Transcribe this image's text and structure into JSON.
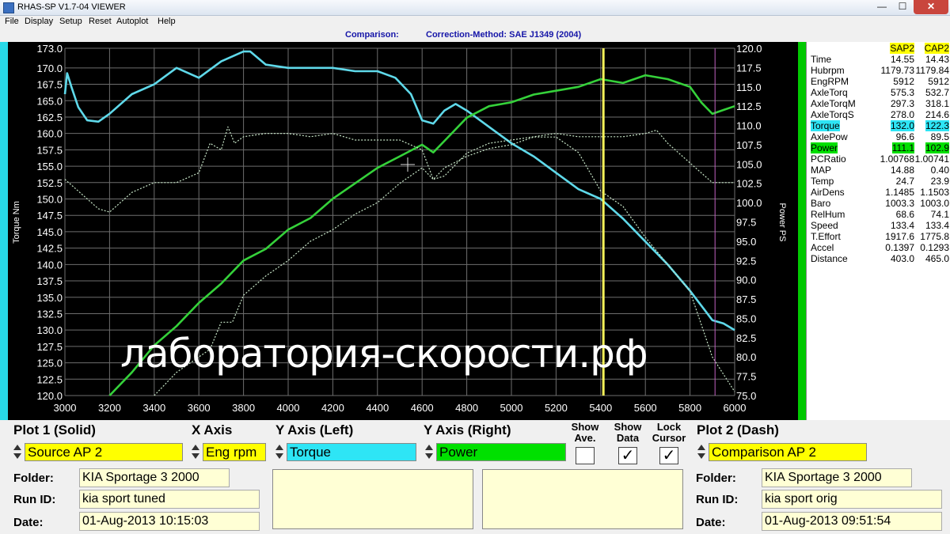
{
  "window": {
    "title": "RHAS-SP V1.7-04  VIEWER",
    "min": "—",
    "max": "☐",
    "close": "✕"
  },
  "menu": [
    {
      "label": "File"
    },
    {
      "label": "Display"
    },
    {
      "label": "Setup"
    },
    {
      "label": "Reset"
    },
    {
      "label": "Autoplot"
    },
    {
      "label": "Help"
    }
  ],
  "header": {
    "comparison": "Comparison:",
    "method": "Correction-Method: SAE J1349 (2004)"
  },
  "chart_data": {
    "type": "line",
    "xlim": [
      3000,
      6000
    ],
    "x_ticks": [
      "3000",
      "3200",
      "3400",
      "3600",
      "3800",
      "4000",
      "4200",
      "4400",
      "4600",
      "4800",
      "5000",
      "5200",
      "5400",
      "5600",
      "5800",
      "6000"
    ],
    "ylim_left": [
      120,
      173
    ],
    "y_left_ticks": [
      "173.0",
      "170.0",
      "167.5",
      "165.0",
      "162.5",
      "160.0",
      "157.5",
      "155.0",
      "152.5",
      "150.0",
      "147.5",
      "145.0",
      "142.5",
      "140.0",
      "137.5",
      "135.0",
      "132.5",
      "130.0",
      "127.5",
      "125.0",
      "122.5",
      "120.0"
    ],
    "ylim_right": [
      75,
      120
    ],
    "y_right_ticks": [
      "120.0",
      "117.5",
      "115.0",
      "112.5",
      "110.0",
      "107.5",
      "105.0",
      "102.5",
      "100.0",
      "97.5",
      "95.0",
      "92.5",
      "90.0",
      "87.5",
      "85.0",
      "82.5",
      "80.0",
      "77.5",
      "75.0"
    ],
    "ylabel_left": "Torque Nm",
    "ylabel_right": "Power PS",
    "grid": true,
    "cursor_x": 5412,
    "cursor2_x": 5912,
    "series": [
      {
        "axis": "left",
        "style": "solid",
        "color": "#5fd9ea",
        "x": [
          3000,
          3010,
          3030,
          3060,
          3100,
          3150,
          3200,
          3300,
          3400,
          3500,
          3600,
          3700,
          3800,
          3830,
          3900,
          4000,
          4100,
          4200,
          4300,
          4400,
          4480,
          4550,
          4600,
          4650,
          4700,
          4750,
          4800,
          4900,
          5000,
          5100,
          5200,
          5300,
          5400,
          5500,
          5600,
          5700,
          5800,
          5900,
          5950,
          6000
        ],
        "y": [
          166,
          169.2,
          167,
          164,
          162,
          161.8,
          163,
          166,
          167.5,
          170,
          168.5,
          171,
          172.5,
          172.5,
          170.5,
          170,
          170,
          170,
          169.5,
          169.5,
          168.5,
          166,
          162,
          161.5,
          163.5,
          164.5,
          163.5,
          161,
          158.5,
          156.5,
          154,
          151.5,
          150,
          147,
          143.5,
          140,
          136,
          131.5,
          131,
          130
        ]
      },
      {
        "axis": "right",
        "style": "solid",
        "color": "#35d13a",
        "x": [
          3200,
          3300,
          3400,
          3500,
          3600,
          3700,
          3800,
          3900,
          4000,
          4100,
          4200,
          4300,
          4400,
          4500,
          4600,
          4650,
          4700,
          4800,
          4900,
          5000,
          5100,
          5200,
          5300,
          5400,
          5500,
          5600,
          5700,
          5800,
          5850,
          5900,
          5950,
          6000
        ],
        "y": [
          75,
          78,
          81.5,
          84,
          87,
          89.5,
          92.5,
          94,
          96.5,
          98,
          100.5,
          102.5,
          104.5,
          106,
          107.5,
          106.5,
          108,
          111,
          112.5,
          113,
          114,
          114.5,
          115,
          116,
          115.5,
          116.5,
          116,
          115,
          113,
          111.5,
          112,
          112.5
        ]
      },
      {
        "axis": "left",
        "style": "dash",
        "color": "#c8e6c8",
        "x": [
          3000,
          3100,
          3150,
          3200,
          3300,
          3400,
          3500,
          3600,
          3650,
          3700,
          3730,
          3760,
          3800,
          3900,
          4000,
          4100,
          4200,
          4300,
          4400,
          4500,
          4600,
          4650,
          4700,
          4800,
          4900,
          5000,
          5100,
          5200,
          5300,
          5400,
          5500,
          5600,
          5650,
          5700,
          5800,
          5900,
          5950,
          6000
        ],
        "y": [
          153,
          150,
          148.5,
          148,
          151,
          152.5,
          152.5,
          154,
          158.5,
          157.5,
          161,
          158.5,
          159.5,
          160,
          160,
          159.5,
          160,
          159,
          159,
          159,
          157.5,
          153,
          153.5,
          157,
          158.5,
          159,
          159.5,
          160,
          159.5,
          159.5,
          159.5,
          160,
          160.5,
          158.5,
          155.5,
          152.5,
          152.5,
          152.5
        ]
      },
      {
        "axis": "right",
        "style": "dash",
        "color": "#c8e6c8",
        "x": [
          3400,
          3500,
          3550,
          3600,
          3650,
          3700,
          3750,
          3800,
          3900,
          4000,
          4100,
          4200,
          4300,
          4400,
          4500,
          4600,
          4650,
          4700,
          4800,
          4900,
          5000,
          5100,
          5200,
          5300,
          5400,
          5500,
          5600,
          5700,
          5800,
          5900,
          6000
        ],
        "y": [
          75,
          78,
          79,
          80,
          81,
          84.5,
          84.5,
          88,
          90.5,
          92.5,
          95,
          96.5,
          98.5,
          100,
          102.5,
          104.5,
          103,
          104.5,
          106,
          107,
          107.5,
          108.5,
          108.5,
          106.5,
          101.5,
          99.5,
          95.5,
          92,
          88.5,
          80,
          75.5
        ]
      }
    ]
  },
  "data_panel": {
    "headers": [
      "SAP2",
      "CAP2"
    ],
    "rows": [
      {
        "label": "Time",
        "v1": "14.55",
        "v2": "14.43"
      },
      {
        "label": "Hubrpm",
        "v1": "1179.73",
        "v2": "1179.84"
      },
      {
        "label": "EngRPM",
        "v1": "5912",
        "v2": "5912"
      },
      {
        "label": "AxleTorq",
        "v1": "575.3",
        "v2": "532.7"
      },
      {
        "label": "AxleTorqM",
        "v1": "297.3",
        "v2": "318.1"
      },
      {
        "label": "AxleTorqS",
        "v1": "278.0",
        "v2": "214.6"
      },
      {
        "label": "Torque",
        "v1": "132.0",
        "v2": "122.3",
        "hl": "cyan"
      },
      {
        "label": "AxlePow",
        "v1": "96.6",
        "v2": "89.5"
      },
      {
        "label": "Power",
        "v1": "111.1",
        "v2": "102.9",
        "hl": "green"
      },
      {
        "label": "PCRatio",
        "v1": "1.00768",
        "v2": "1.00741"
      },
      {
        "label": "MAP",
        "v1": "14.88",
        "v2": "0.40"
      },
      {
        "label": "Temp",
        "v1": "24.7",
        "v2": "23.9"
      },
      {
        "label": "AirDens",
        "v1": "1.1485",
        "v2": "1.1503"
      },
      {
        "label": "Baro",
        "v1": "1003.3",
        "v2": "1003.0"
      },
      {
        "label": "RelHum",
        "v1": "68.6",
        "v2": "74.1"
      },
      {
        "label": "Speed",
        "v1": "133.4",
        "v2": "133.4"
      },
      {
        "label": "T.Effort",
        "v1": "1917.6",
        "v2": "1775.8"
      },
      {
        "label": "Accel",
        "v1": "0.1397",
        "v2": "0.1293"
      },
      {
        "label": "Distance",
        "v1": "403.0",
        "v2": "465.0"
      }
    ]
  },
  "controls": {
    "plot1_header": "Plot 1 (Solid)",
    "xaxis_header": "X Axis",
    "yleft_header": "Y Axis (Left)",
    "yright_header": "Y Axis (Right)",
    "show_ave": "Show Ave.",
    "show_data": "Show Data",
    "lock_cursor": "Lock Cursor",
    "plot2_header": "Plot 2 (Dash)",
    "plot1_value": "Source AP 2",
    "xaxis_value": "Eng rpm",
    "yleft_value": "Torque",
    "yright_value": "Power",
    "plot2_value": "Comparison AP 2",
    "check_mark": "✓"
  },
  "run1": {
    "folder_label": "Folder:",
    "folder": "KIA Sportage 3 2000",
    "runid_label": "Run ID:",
    "runid": "kia sport tuned",
    "date_label": "Date:",
    "date": "01-Aug-2013  10:15:03"
  },
  "run2": {
    "folder_label": "Folder:",
    "folder": "KIA Sportage 3 2000",
    "runid_label": "Run ID:",
    "runid": "kia sport orig",
    "date_label": "Date:",
    "date": "01-Aug-2013  09:51:54"
  },
  "watermark": "лаборатория-скорости.рф"
}
